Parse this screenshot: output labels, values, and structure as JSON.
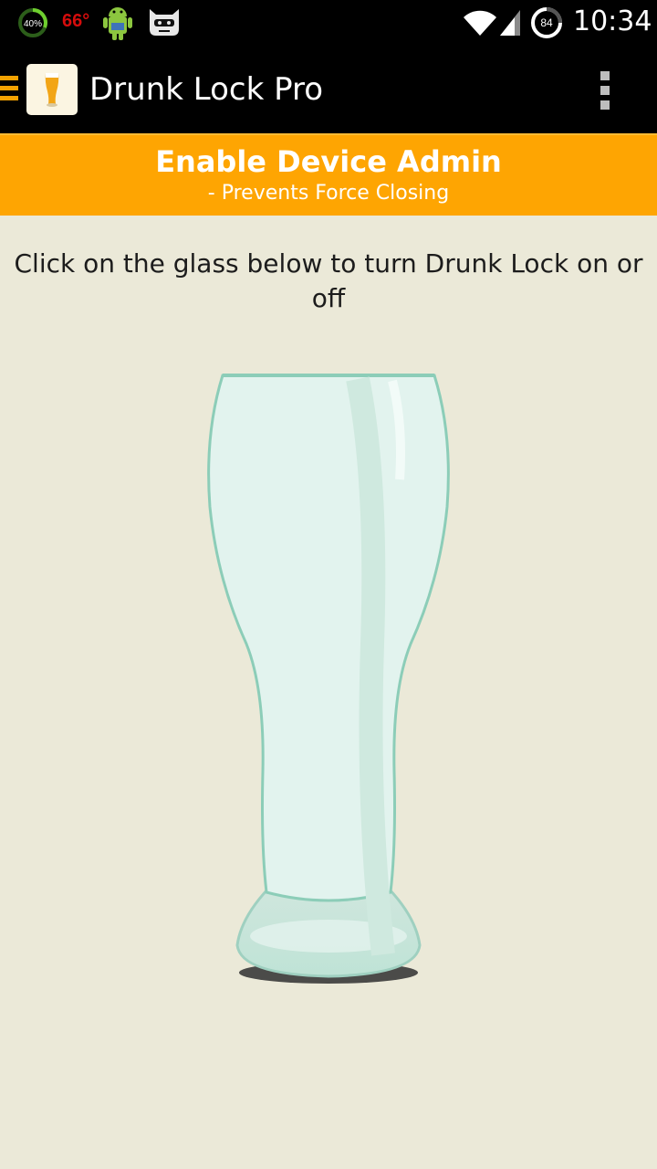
{
  "status_bar": {
    "battery_text": "40%",
    "temperature": "66°",
    "circle_badge": "84",
    "time": "10:34"
  },
  "action_bar": {
    "title": "Drunk Lock Pro",
    "icons": [
      "drawer-menu-icon",
      "beer-glass-app-icon",
      "overflow-menu-icon"
    ]
  },
  "admin_banner": {
    "title": "Enable Device Admin",
    "subtitle": "- Prevents Force Closing"
  },
  "main": {
    "instruction": "Click on the glass below to turn Drunk Lock on or off",
    "glass_icon": "pilsner-glass-icon"
  },
  "colors": {
    "status_bar_bg": "#000000",
    "accent": "#fea502",
    "background": "#ebe9d8",
    "temperature_text": "#d40c0c"
  }
}
